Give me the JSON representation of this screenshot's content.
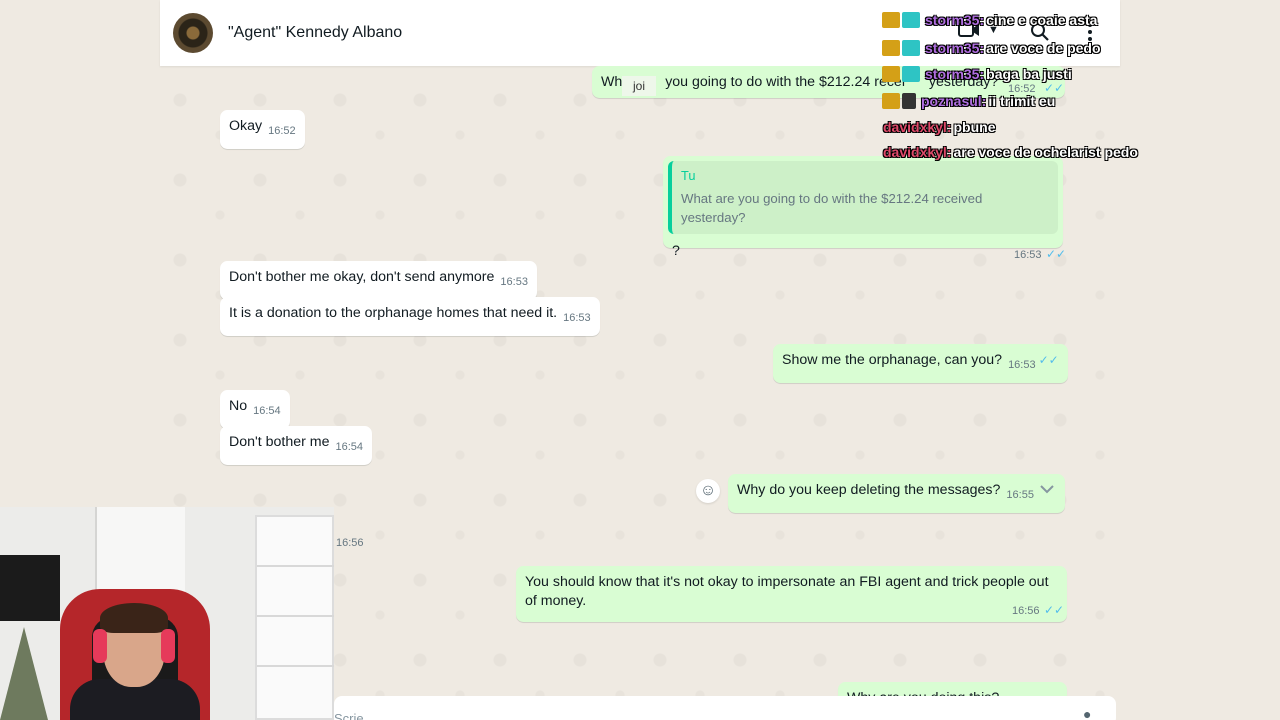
{
  "header": {
    "contact_name": "\"Agent\" Kennedy Albano",
    "icons": [
      "video-call-icon",
      "chevron-down-icon",
      "search-icon",
      "more-options-icon"
    ]
  },
  "messages": [
    {
      "dir": "out",
      "text_visible_left": "Wh",
      "text_visible_right": "you going to do with the $212.24 recei",
      "text_tail": "yesterday?",
      "time": "16:52",
      "ticks": "✓✓"
    },
    {
      "dir": "in",
      "text": "Okay",
      "time": "16:52"
    },
    {
      "dir": "out",
      "quote_author": "Tu",
      "quote_text": "What are you going to do with the $212.24 received yesterday?",
      "text": "?",
      "time": "16:53",
      "ticks": "✓✓"
    },
    {
      "dir": "in",
      "text": "Don't bother me okay, don't send anymore",
      "time": "16:53"
    },
    {
      "dir": "in",
      "text": "It is a donation to the orphanage homes that need it.",
      "time": "16:53"
    },
    {
      "dir": "out",
      "text": "Show me the orphanage, can you?",
      "time": "16:53",
      "ticks": "✓✓"
    },
    {
      "dir": "in",
      "text": "No",
      "time": "16:54"
    },
    {
      "dir": "in",
      "text": "Don't bother me",
      "time": "16:54"
    },
    {
      "dir": "out",
      "text": "Why do you keep deleting the messages?",
      "time": "16:55"
    },
    {
      "dir": "in",
      "text": "",
      "time": "16:56"
    },
    {
      "dir": "out",
      "text": "You should know that it's not okay to impersonate an FBI agent and trick people out of money.",
      "time": "16:56",
      "ticks": "✓✓"
    },
    {
      "dir": "out",
      "text": "Why are you doing this?",
      "time": ""
    }
  ],
  "overlay_tag": "joi",
  "stream_chat": [
    {
      "user": "storm35:",
      "text": "cine e coaie asta",
      "color": "#b06ee0"
    },
    {
      "user": "storm35:",
      "text": "are voce de pedo",
      "color": "#b06ee0"
    },
    {
      "user": "storm35:",
      "text": "baga ba justi",
      "color": "#b06ee0"
    },
    {
      "user": "poznasul:",
      "text": "ii trimit eu",
      "color": "#b06ee0"
    },
    {
      "user": "davidxkyl:",
      "text": "pbune",
      "color": "#e04a6a"
    },
    {
      "user": "davidxkyl:",
      "text": "are voce de ochelarist pedo",
      "color": "#e04a6a"
    }
  ],
  "composer": {
    "placeholder": "Scrie"
  },
  "colors": {
    "chat_bg": "#efeae2",
    "incoming_bubble": "#ffffff",
    "outgoing_bubble": "#d9fdd3",
    "read_ticks": "#53bdeb",
    "quote_accent": "#06cf9c"
  }
}
